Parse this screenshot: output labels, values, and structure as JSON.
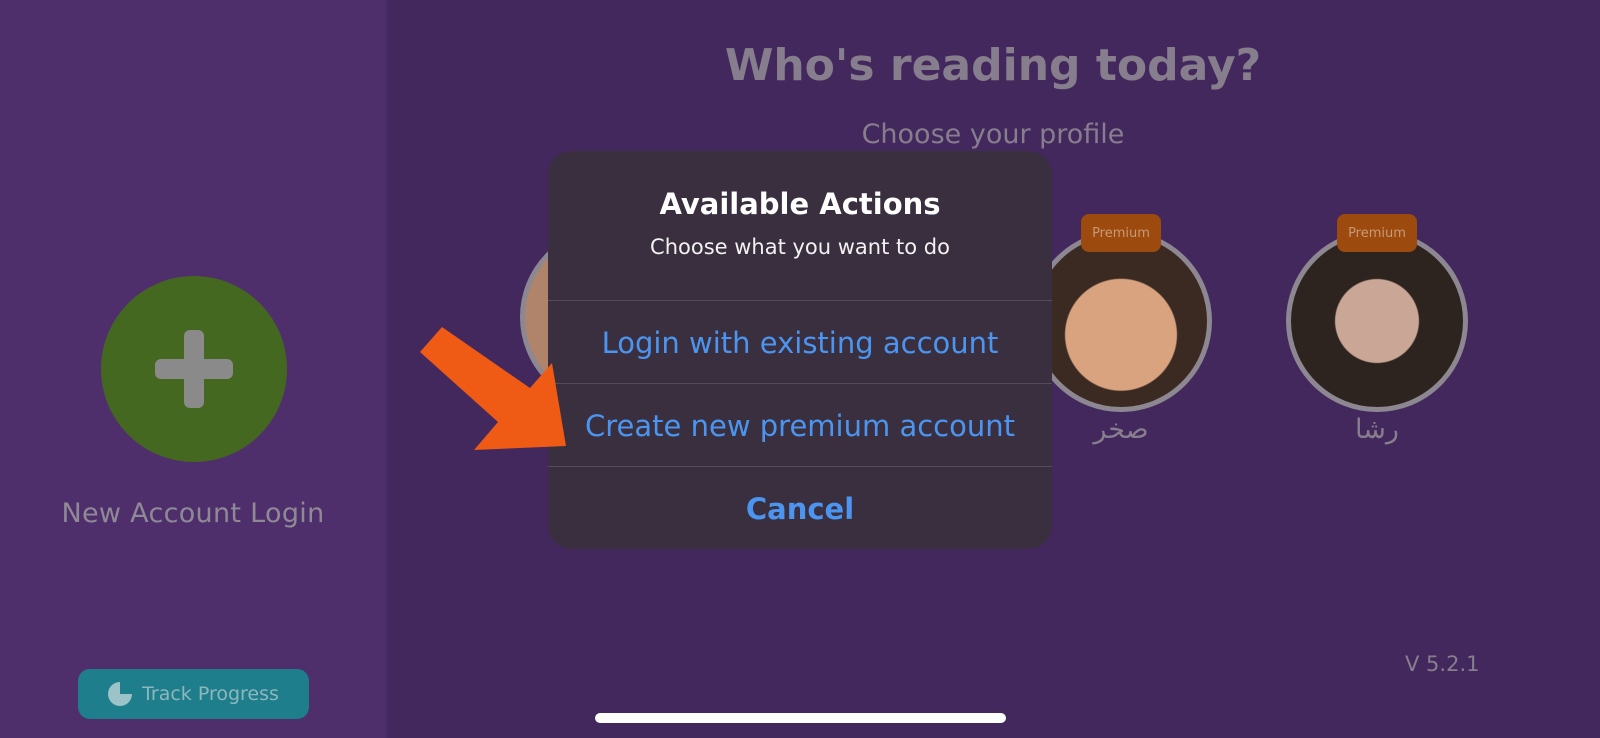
{
  "sidebar": {
    "new_account_label": "New Account Login",
    "track_progress_label": "Track Progress",
    "add_icon": "plus-icon",
    "track_icon": "pie-chart-icon"
  },
  "main": {
    "title": "Who's reading today?",
    "subtitle": "Choose your profile",
    "profiles": [
      {
        "name": "",
        "badge": ""
      },
      {
        "name": "صخر",
        "badge": "Premium"
      },
      {
        "name": "رشا",
        "badge": "Premium"
      }
    ],
    "version": "V 5.2.1"
  },
  "dialog": {
    "title": "Available Actions",
    "subtitle": "Choose what you want to do",
    "actions": [
      {
        "label": "Login with existing account"
      },
      {
        "label": "Create new premium account"
      },
      {
        "label": "Cancel"
      }
    ]
  },
  "colors": {
    "background": "#43285d",
    "sidebar": "#4e2f6c",
    "add_button": "#456820",
    "track_button": "#1f7e8c",
    "premium_badge": "#9d4a0e",
    "dialog_bg": "#3a2f3e",
    "action_text": "#4b95f0",
    "annotation_arrow": "#ef5a15"
  }
}
